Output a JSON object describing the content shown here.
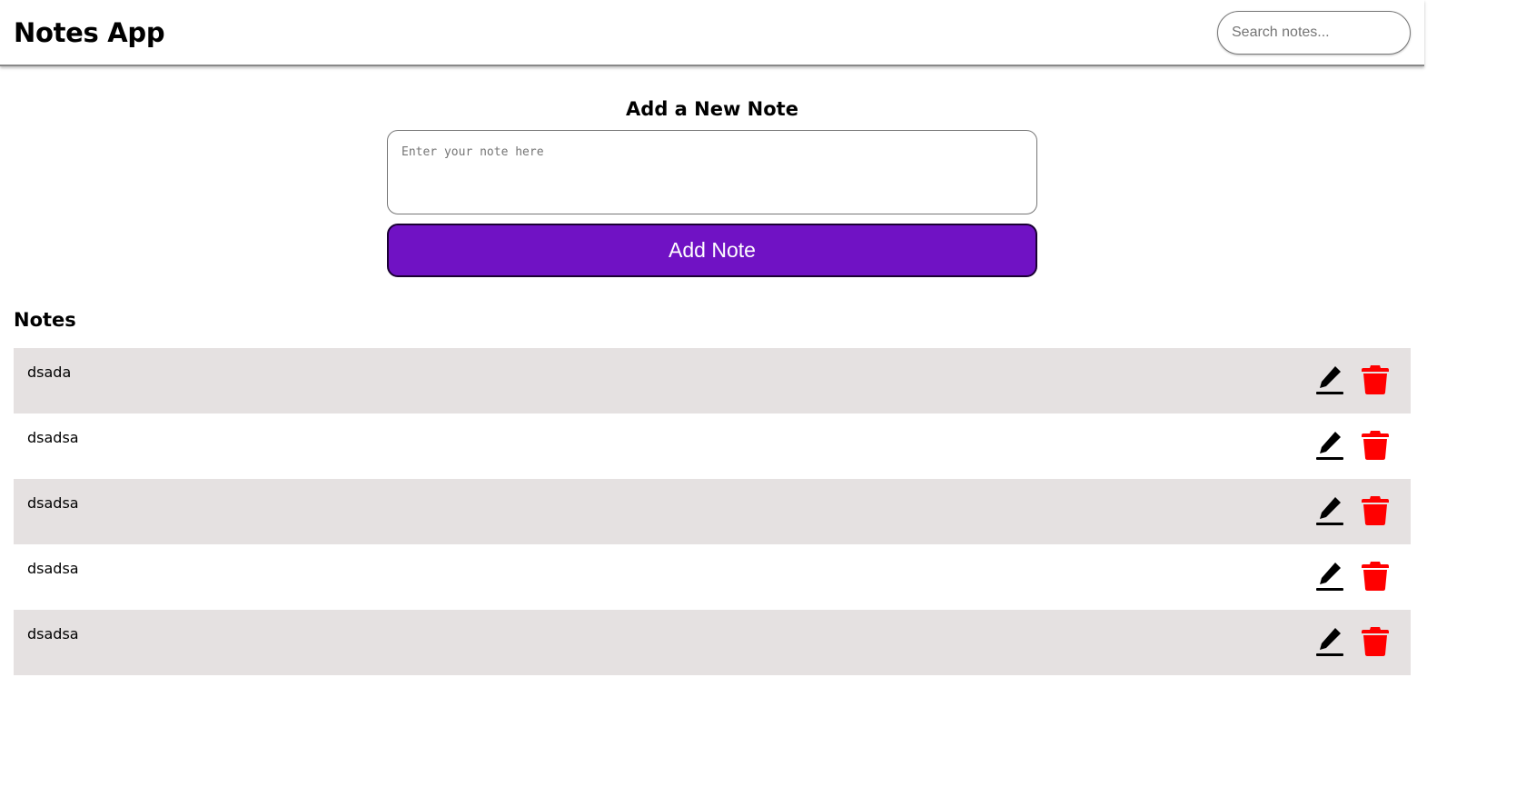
{
  "header": {
    "title": "Notes App",
    "search_placeholder": "Search notes..."
  },
  "add_section": {
    "title": "Add a New Note",
    "textarea_placeholder": "Enter your note here",
    "button_label": "Add Note",
    "button_color": "#7012c4"
  },
  "notes_section": {
    "title": "Notes",
    "notes": [
      {
        "text": "dsada",
        "edit_icon": "edit-icon",
        "delete_icon": "trash-icon"
      },
      {
        "text": "dsadsa",
        "edit_icon": "edit-icon",
        "delete_icon": "trash-icon"
      },
      {
        "text": "dsadsa",
        "edit_icon": "edit-icon",
        "delete_icon": "trash-icon"
      },
      {
        "text": "dsadsa",
        "edit_icon": "edit-icon",
        "delete_icon": "trash-icon"
      },
      {
        "text": "dsadsa",
        "edit_icon": "edit-icon",
        "delete_icon": "trash-icon"
      }
    ]
  },
  "colors": {
    "row_shade": "#e5e1e1",
    "delete_icon": "#ff0000",
    "edit_icon": "#000000"
  }
}
